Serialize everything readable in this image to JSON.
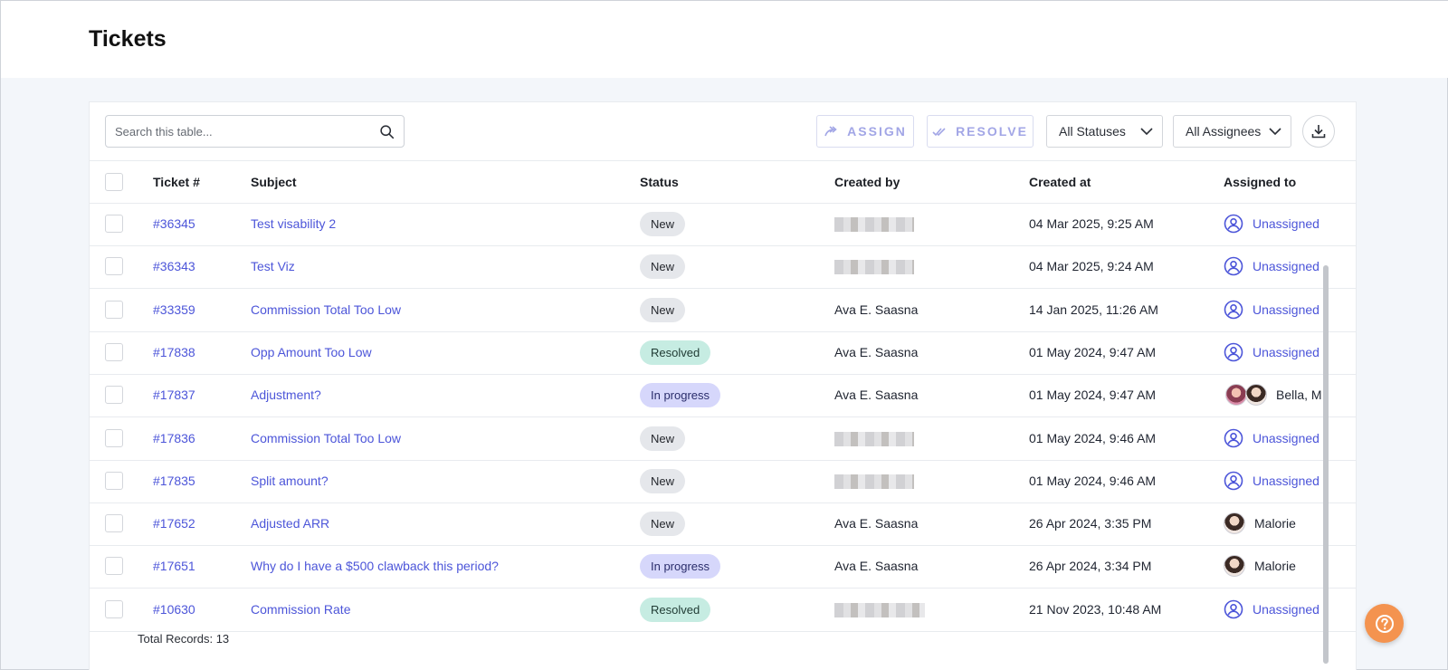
{
  "page": {
    "title": "Tickets"
  },
  "toolbar": {
    "search_placeholder": "Search this table...",
    "assign_label": "ASSIGN",
    "resolve_label": "RESOLVE",
    "status_filter": "All Statuses",
    "assignee_filter": "All Assignees"
  },
  "columns": {
    "ticket": "Ticket #",
    "subject": "Subject",
    "status": "Status",
    "created_by": "Created by",
    "created_at": "Created at",
    "assigned_to": "Assigned to"
  },
  "rows": [
    {
      "ticket": "#36345",
      "subject": "Test visability 2",
      "status": "New",
      "status_type": "new",
      "created_by": "",
      "created_by_redacted": true,
      "created_at": "04 Mar 2025, 9:25 AM",
      "assigned_to": "Unassigned",
      "assignee_type": "unassigned"
    },
    {
      "ticket": "#36343",
      "subject": "Test Viz",
      "status": "New",
      "status_type": "new",
      "created_by": "",
      "created_by_redacted": true,
      "created_at": "04 Mar 2025, 9:24 AM",
      "assigned_to": "Unassigned",
      "assignee_type": "unassigned"
    },
    {
      "ticket": "#33359",
      "subject": "Commission Total Too Low",
      "status": "New",
      "status_type": "new",
      "created_by": "Ava E. Saasna",
      "created_by_redacted": false,
      "created_at": "14 Jan 2025, 11:26 AM",
      "assigned_to": "Unassigned",
      "assignee_type": "unassigned"
    },
    {
      "ticket": "#17838",
      "subject": "Opp Amount Too Low",
      "status": "Resolved",
      "status_type": "resolved",
      "created_by": "Ava E. Saasna",
      "created_by_redacted": false,
      "created_at": "01 May 2024, 9:47 AM",
      "assigned_to": "Unassigned",
      "assignee_type": "unassigned"
    },
    {
      "ticket": "#17837",
      "subject": "Adjustment?",
      "status": "In progress",
      "status_type": "progress",
      "created_by": "Ava E. Saasna",
      "created_by_redacted": false,
      "created_at": "01 May 2024, 9:47 AM",
      "assigned_to": "Bella, M",
      "assignee_type": "multi"
    },
    {
      "ticket": "#17836",
      "subject": "Commission Total Too Low",
      "status": "New",
      "status_type": "new",
      "created_by": "",
      "created_by_redacted": true,
      "created_at": "01 May 2024, 9:46 AM",
      "assigned_to": "Unassigned",
      "assignee_type": "unassigned"
    },
    {
      "ticket": "#17835",
      "subject": "Split amount?",
      "status": "New",
      "status_type": "new",
      "created_by": "",
      "created_by_redacted": true,
      "created_at": "01 May 2024, 9:46 AM",
      "assigned_to": "Unassigned",
      "assignee_type": "unassigned"
    },
    {
      "ticket": "#17652",
      "subject": "Adjusted ARR",
      "status": "New",
      "status_type": "new",
      "created_by": "Ava E. Saasna",
      "created_by_redacted": false,
      "created_at": "26 Apr 2024, 3:35 PM",
      "assigned_to": "Malorie",
      "assignee_type": "single"
    },
    {
      "ticket": "#17651",
      "subject": "Why do I have a $500 clawback this period?",
      "status": "In progress",
      "status_type": "progress",
      "created_by": "Ava E. Saasna",
      "created_by_redacted": false,
      "created_at": "26 Apr 2024, 3:34 PM",
      "assigned_to": "Malorie",
      "assignee_type": "single"
    },
    {
      "ticket": "#10630",
      "subject": "Commission Rate",
      "status": "Resolved",
      "status_type": "resolved",
      "created_by": "",
      "created_by_redacted": true,
      "created_at": "21 Nov 2023, 10:48 AM",
      "assigned_to": "Unassigned",
      "assignee_type": "unassigned"
    }
  ],
  "footer": {
    "total_records": "Total Records: 13"
  },
  "icons": {
    "search": "search-icon",
    "assign": "assign-arrow-icon",
    "resolve": "double-check-icon",
    "chevron": "chevron-down-icon",
    "download": "download-icon",
    "user": "user-circle-icon",
    "help": "help-icon"
  },
  "colors": {
    "link": "#4c55d9",
    "badge_new": "#e5e7eb",
    "badge_resolved": "#c6ece2",
    "badge_progress": "#d6d7fb",
    "help_button": "#f4934f"
  }
}
